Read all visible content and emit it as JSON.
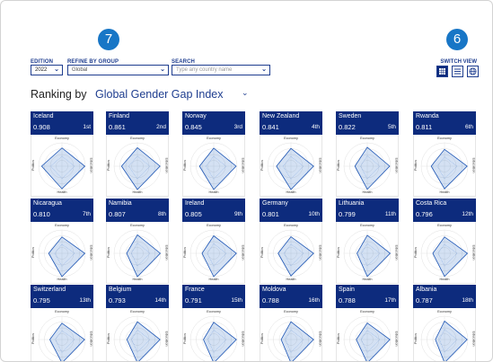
{
  "badges": {
    "filters": "7",
    "switch_view": "6"
  },
  "controls": {
    "edition_label": "EDITION",
    "edition_value": "2022",
    "group_label": "REFINE BY GROUP",
    "group_value": "Global",
    "search_label": "SEARCH",
    "search_placeholder": "Type any country name",
    "switch_view_label": "SWITCH VIEW",
    "views": [
      "grid-icon",
      "list-icon",
      "globe-icon"
    ]
  },
  "ranking": {
    "prefix": "Ranking by",
    "index": "Global Gender Gap Index"
  },
  "axis_labels": {
    "top": "Economy",
    "bottom": "Health",
    "left": "Politics",
    "right": "Education"
  },
  "countries": [
    {
      "name": "Iceland",
      "score": "0.908",
      "rank": "1st",
      "shape": [
        0.78,
        0.98,
        0.97,
        0.87
      ]
    },
    {
      "name": "Finland",
      "score": "0.861",
      "rank": "2nd",
      "shape": [
        0.79,
        0.97,
        1.0,
        0.68
      ]
    },
    {
      "name": "Norway",
      "score": "0.845",
      "rank": "3rd",
      "shape": [
        0.77,
        0.96,
        1.0,
        0.61
      ]
    },
    {
      "name": "New Zealand",
      "score": "0.841",
      "rank": "4th",
      "shape": [
        0.76,
        0.97,
        1.0,
        0.62
      ]
    },
    {
      "name": "Sweden",
      "score": "0.822",
      "rank": "5th",
      "shape": [
        0.81,
        0.96,
        0.99,
        0.53
      ]
    },
    {
      "name": "Rwanda",
      "score": "0.811",
      "rank": "6th",
      "shape": [
        0.72,
        0.97,
        0.97,
        0.57
      ]
    },
    {
      "name": "Nicaragua",
      "score": "0.810",
      "rank": "7th",
      "shape": [
        0.7,
        0.98,
        1.0,
        0.57
      ]
    },
    {
      "name": "Namibia",
      "score": "0.807",
      "rank": "8th",
      "shape": [
        0.79,
        0.98,
        1.0,
        0.46
      ]
    },
    {
      "name": "Ireland",
      "score": "0.805",
      "rank": "9th",
      "shape": [
        0.75,
        0.97,
        1.0,
        0.5
      ]
    },
    {
      "name": "Germany",
      "score": "0.801",
      "rank": "10th",
      "shape": [
        0.71,
        0.97,
        0.97,
        0.55
      ]
    },
    {
      "name": "Lithuania",
      "score": "0.799",
      "rank": "11th",
      "shape": [
        0.77,
        0.98,
        0.99,
        0.44
      ]
    },
    {
      "name": "Costa Rica",
      "score": "0.796",
      "rank": "12th",
      "shape": [
        0.7,
        0.98,
        0.99,
        0.5
      ]
    },
    {
      "name": "Switzerland",
      "score": "0.795",
      "rank": "13th",
      "shape": [
        0.7,
        0.97,
        1.0,
        0.52
      ]
    },
    {
      "name": "Belgium",
      "score": "0.793",
      "rank": "14th",
      "shape": [
        0.76,
        0.97,
        0.99,
        0.45
      ]
    },
    {
      "name": "France",
      "score": "0.791",
      "rank": "15th",
      "shape": [
        0.74,
        0.97,
        1.0,
        0.44
      ]
    },
    {
      "name": "Moldova",
      "score": "0.788",
      "rank": "16th",
      "shape": [
        0.76,
        0.97,
        1.0,
        0.42
      ]
    },
    {
      "name": "Spain",
      "score": "0.788",
      "rank": "17th",
      "shape": [
        0.71,
        0.97,
        1.0,
        0.47
      ]
    },
    {
      "name": "Albania",
      "score": "0.787",
      "rank": "18th",
      "shape": [
        0.79,
        0.97,
        0.99,
        0.39
      ]
    }
  ]
}
